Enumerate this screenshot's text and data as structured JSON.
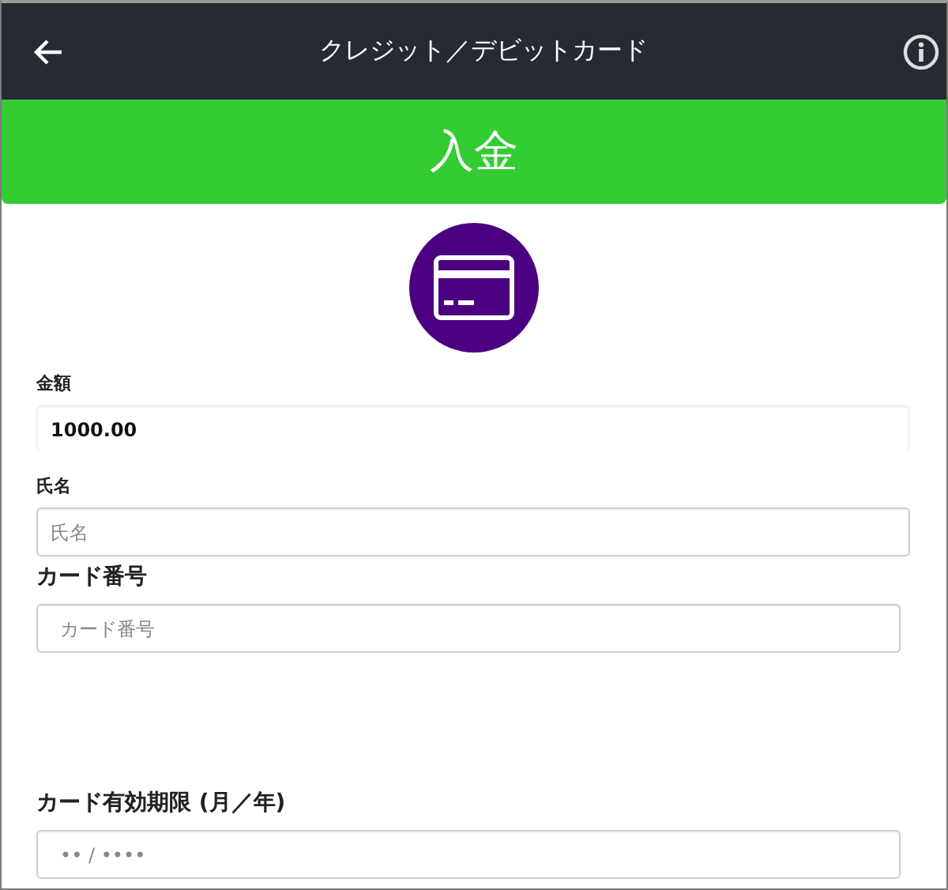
{
  "header": {
    "title": "クレジット／デビットカード"
  },
  "banner": {
    "title": "入金"
  },
  "fields": [
    {
      "kind": "readonly",
      "label": "金額",
      "value": "1000.00"
    },
    {
      "kind": "small",
      "label": "氏名",
      "placeholder": "氏名"
    },
    {
      "kind": "large",
      "label": "カード番号",
      "placeholder": "カード番号"
    },
    {
      "kind": "spaced",
      "label": "カード有効期限 (月／年)",
      "placeholder": "•• / ••••"
    }
  ]
}
